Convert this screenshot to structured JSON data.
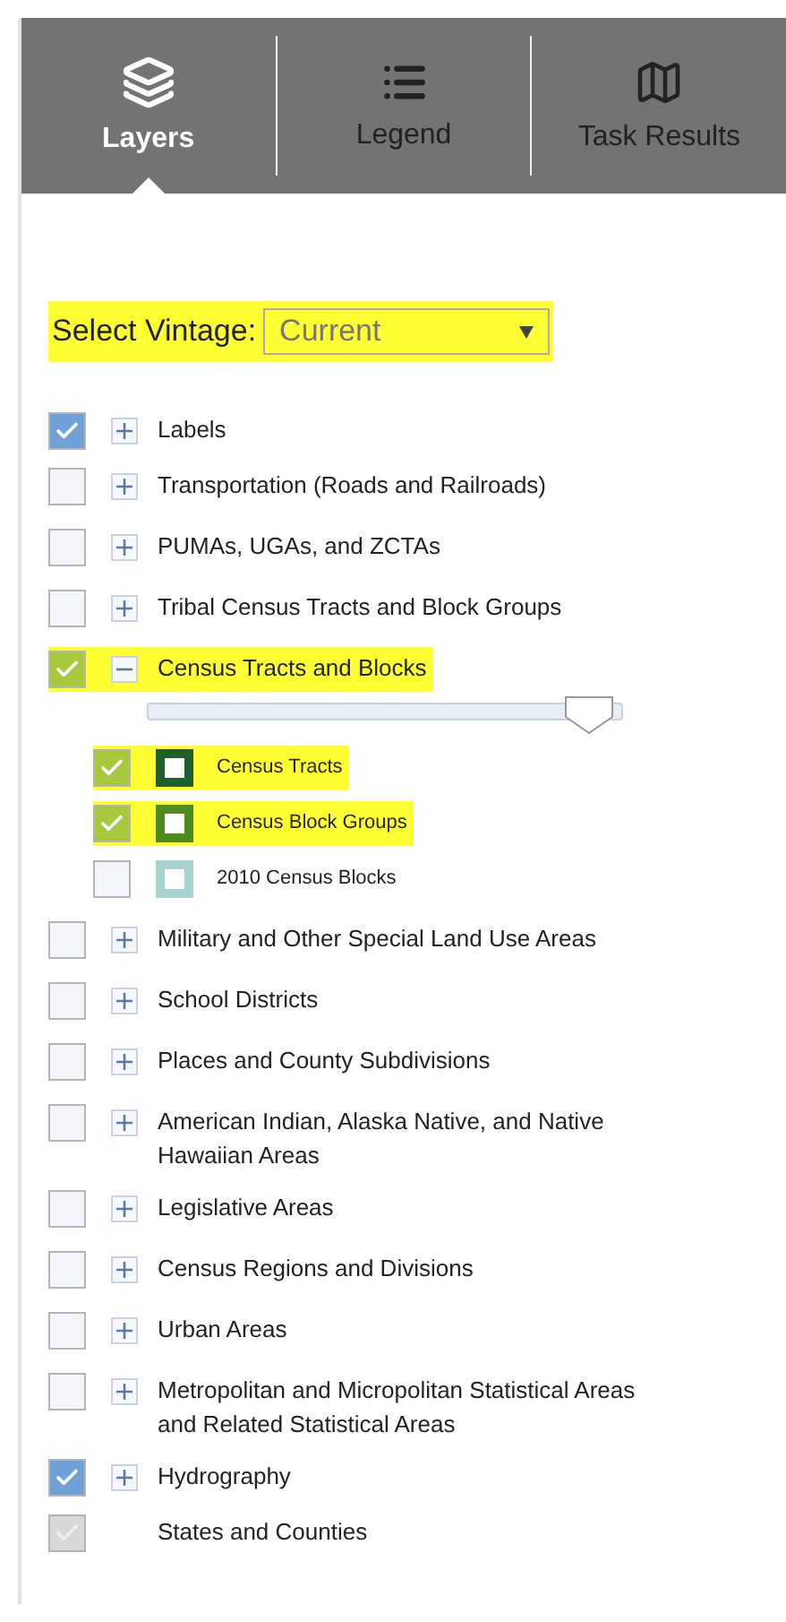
{
  "tabs": [
    {
      "label": "Layers",
      "selected": true
    },
    {
      "label": "Legend",
      "selected": false
    },
    {
      "label": "Task Results",
      "selected": false
    }
  ],
  "vintage": {
    "label": "Select Vintage:",
    "value": "Current",
    "highlighted": true
  },
  "layers": [
    {
      "kind": "group",
      "label": "Labels",
      "checked": true,
      "expanded": false,
      "highlighted": false
    },
    {
      "kind": "group",
      "label": "Transportation (Roads and Railroads)",
      "checked": false,
      "expanded": false,
      "highlighted": false
    },
    {
      "kind": "group",
      "label": "PUMAs, UGAs, and ZCTAs",
      "checked": false,
      "expanded": false,
      "highlighted": false
    },
    {
      "kind": "group",
      "label": "Tribal Census Tracts and Block Groups",
      "checked": false,
      "expanded": false,
      "highlighted": false
    },
    {
      "kind": "group",
      "label": "Census Tracts and Blocks",
      "checked": true,
      "expanded": true,
      "highlighted": true,
      "level": 0.93,
      "children": [
        {
          "label": "Census Tracts",
          "checked": true,
          "highlighted": true,
          "color": "#1f5f2b"
        },
        {
          "label": "Census Block Groups",
          "checked": true,
          "highlighted": true,
          "color": "#4d8c1f"
        },
        {
          "label": "2010 Census Blocks",
          "checked": false,
          "highlighted": false,
          "color": "#a6d3cf"
        }
      ]
    },
    {
      "kind": "group",
      "label": "Military and Other Special Land Use Areas",
      "checked": false,
      "expanded": false,
      "highlighted": false
    },
    {
      "kind": "group",
      "label": "School Districts",
      "checked": false,
      "expanded": false,
      "highlighted": false
    },
    {
      "kind": "group",
      "label": "Places and County Subdivisions",
      "checked": false,
      "expanded": false,
      "highlighted": false
    },
    {
      "kind": "group",
      "label": "American Indian, Alaska Native, and Native Hawaiian Areas",
      "checked": false,
      "expanded": false,
      "highlighted": false
    },
    {
      "kind": "group",
      "label": "Legislative Areas",
      "checked": false,
      "expanded": false,
      "highlighted": false
    },
    {
      "kind": "group",
      "label": "Census Regions and Divisions",
      "checked": false,
      "expanded": false,
      "highlighted": false
    },
    {
      "kind": "group",
      "label": "Urban Areas",
      "checked": false,
      "expanded": false,
      "highlighted": false
    },
    {
      "kind": "group",
      "label": "Metropolitan and Micropolitan Statistical Areas and Related Statistical Areas",
      "checked": false,
      "expanded": false,
      "highlighted": false
    },
    {
      "kind": "group",
      "label": "Hydrography",
      "checked": true,
      "expanded": false,
      "highlighted": false
    },
    {
      "kind": "fixed",
      "label": "States and Counties",
      "checked": true,
      "highlighted": false
    }
  ]
}
